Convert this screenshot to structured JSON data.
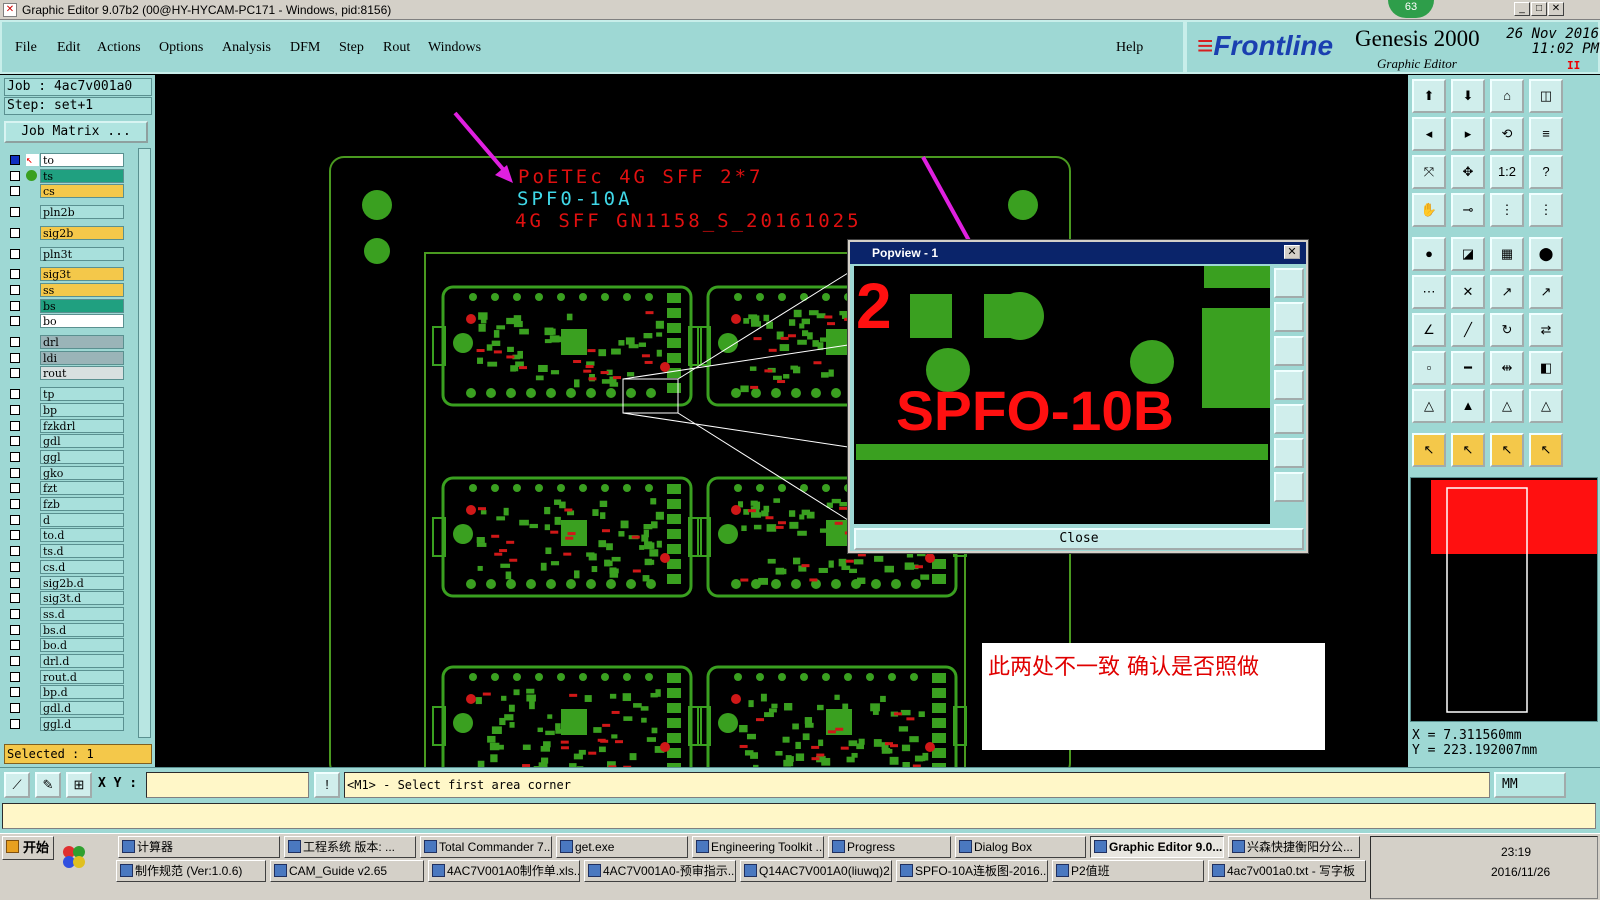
{
  "window": {
    "title": "Graphic Editor 9.07b2 (00@HY-HYCAM-PC171 - Windows, pid:8156)",
    "badge": "63"
  },
  "menu": {
    "items": [
      "File",
      "Edit",
      "Actions",
      "Options",
      "Analysis",
      "DFM",
      "Step",
      "Rout",
      "Windows"
    ],
    "help": "Help"
  },
  "brand": {
    "logo": "Frontline",
    "product": "Genesis 2000",
    "subtitle": "Graphic Editor",
    "date": "26 Nov 2016",
    "time": "11:02 PM",
    "pause": "II"
  },
  "job": {
    "job": "Job : 4ac7v001a0",
    "step": "Step: set+1",
    "matrix_button": "Job Matrix ..."
  },
  "layers": [
    {
      "name": "to",
      "color": "#ffffff",
      "checked": true
    },
    {
      "name": "ts",
      "color": "#20a080",
      "checked": false
    },
    {
      "name": "cs",
      "color": "#f4c84a",
      "checked": false
    },
    {
      "name": "pln2b",
      "color": "#a8e0dc",
      "checked": false
    },
    {
      "name": "sig2b",
      "color": "#f4c84a",
      "checked": false
    },
    {
      "name": "pln3t",
      "color": "#a8e0dc",
      "checked": false
    },
    {
      "name": "sig3t",
      "color": "#f4c84a",
      "checked": false
    },
    {
      "name": "ss",
      "color": "#f4c84a",
      "checked": false
    },
    {
      "name": "bs",
      "color": "#20a080",
      "checked": false
    },
    {
      "name": "bo",
      "color": "#ffffff",
      "checked": false
    },
    {
      "name": "drl",
      "color": "#9ab4b8",
      "checked": false
    },
    {
      "name": "ldi",
      "color": "#9ab4b8",
      "checked": false
    },
    {
      "name": "rout",
      "color": "#d8e0e0",
      "checked": false
    },
    {
      "name": "tp",
      "color": "#a8e0dc",
      "checked": false
    },
    {
      "name": "bp",
      "color": "#a8e0dc",
      "checked": false
    },
    {
      "name": "fzkdrl",
      "color": "#a8e0dc",
      "checked": false
    },
    {
      "name": "gdl",
      "color": "#a8e0dc",
      "checked": false
    },
    {
      "name": "ggl",
      "color": "#a8e0dc",
      "checked": false
    },
    {
      "name": "gko",
      "color": "#a8e0dc",
      "checked": false
    },
    {
      "name": "fzt",
      "color": "#a8e0dc",
      "checked": false
    },
    {
      "name": "fzb",
      "color": "#a8e0dc",
      "checked": false
    },
    {
      "name": "d",
      "color": "#a8e0dc",
      "checked": false
    },
    {
      "name": "to.d",
      "color": "#a8e0dc",
      "checked": false
    },
    {
      "name": "ts.d",
      "color": "#a8e0dc",
      "checked": false
    },
    {
      "name": "cs.d",
      "color": "#a8e0dc",
      "checked": false
    },
    {
      "name": "sig2b.d",
      "color": "#a8e0dc",
      "checked": false
    },
    {
      "name": "sig3t.d",
      "color": "#a8e0dc",
      "checked": false
    },
    {
      "name": "ss.d",
      "color": "#a8e0dc",
      "checked": false
    },
    {
      "name": "bs.d",
      "color": "#a8e0dc",
      "checked": false
    },
    {
      "name": "bo.d",
      "color": "#a8e0dc",
      "checked": false
    },
    {
      "name": "drl.d",
      "color": "#a8e0dc",
      "checked": false
    },
    {
      "name": "rout.d",
      "color": "#a8e0dc",
      "checked": false
    },
    {
      "name": "bp.d",
      "color": "#a8e0dc",
      "checked": false
    },
    {
      "name": "gdl.d",
      "color": "#a8e0dc",
      "checked": false
    },
    {
      "name": "ggl.d",
      "color": "#a8e0dc",
      "checked": false
    }
  ],
  "selected": "Selected : 1",
  "board": {
    "text_line1": "PoETEc 4G SFF 2*7",
    "text_line2": "SPF0-10A",
    "text_line3": "4G SFF GN1158_S_20161025"
  },
  "popview": {
    "title": "Popview - 1",
    "label": "SPFO-10B",
    "number": "2",
    "close": "Close"
  },
  "note": "此两处不一致   确认是否照做",
  "toolbox": {
    "ratio_label": "1:2"
  },
  "coords": {
    "x": "X = 7.311560mm",
    "y": "Y = 223.192007mm"
  },
  "command": {
    "xy_label": "X Y :",
    "xy_value": "",
    "prompt": "<M1> - Select first area corner",
    "units": "MM"
  },
  "taskbar": {
    "start": "开始",
    "row1": [
      "计算器",
      "工程系统  版本: ...",
      "Total Commander 7...",
      "get.exe",
      "Engineering Toolkit ...",
      "Progress",
      "Dialog Box",
      "Graphic Editor 9.0...",
      "兴森快捷衡阳分公..."
    ],
    "row2": [
      "制作规范 (Ver:1.0.6)",
      "CAM_Guide v2.65",
      "4AC7V001A0制作单.xls...",
      "4AC7V001A0-预审指示...",
      "Q14AC7V001A0(liuwq)2...",
      "SPFO-10A连板图-2016...",
      "P2值班",
      "4ac7v001a0.txt - 写字板"
    ],
    "time": "23:19",
    "date": "2016/11/26"
  }
}
